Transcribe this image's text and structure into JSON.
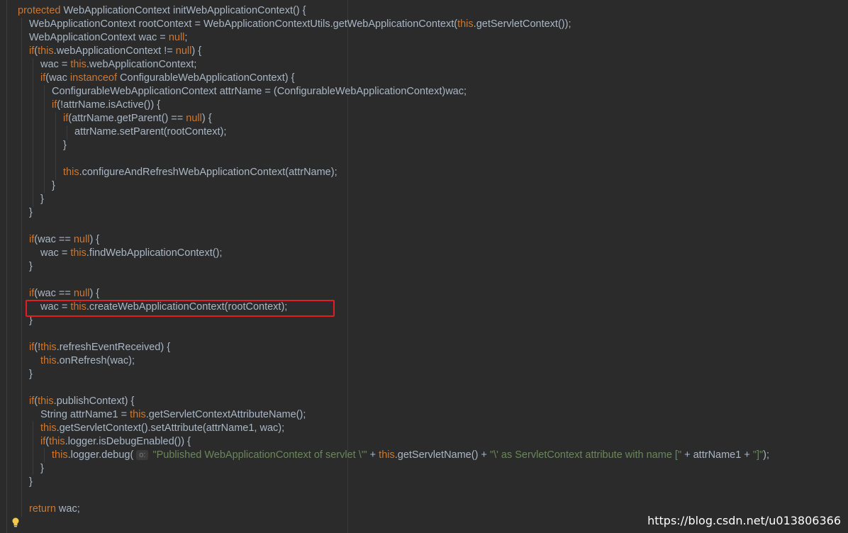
{
  "editor": {
    "lines": [
      {
        "indent": 0,
        "tokens": [
          [
            "kw",
            "protected "
          ],
          [
            "id",
            "WebApplicationContext initWebApplicationContext() {"
          ]
        ]
      },
      {
        "indent": 1,
        "tokens": [
          [
            "id",
            "WebApplicationContext rootContext = WebApplicationContextUtils.getWebApplicationContext("
          ],
          [
            "kw",
            "this"
          ],
          [
            "id",
            ".getServletContext());"
          ]
        ]
      },
      {
        "indent": 1,
        "tokens": [
          [
            "id",
            "WebApplicationContext wac = "
          ],
          [
            "kw",
            "null"
          ],
          [
            "id",
            ";"
          ]
        ]
      },
      {
        "indent": 1,
        "tokens": [
          [
            "kw",
            "if"
          ],
          [
            "id",
            "("
          ],
          [
            "kw",
            "this"
          ],
          [
            "id",
            ".webApplicationContext != "
          ],
          [
            "kw",
            "null"
          ],
          [
            "id",
            ") {"
          ]
        ]
      },
      {
        "indent": 2,
        "tokens": [
          [
            "id",
            "wac = "
          ],
          [
            "kw",
            "this"
          ],
          [
            "id",
            ".webApplicationContext;"
          ]
        ]
      },
      {
        "indent": 2,
        "tokens": [
          [
            "kw",
            "if"
          ],
          [
            "id",
            "(wac "
          ],
          [
            "kw",
            "instanceof "
          ],
          [
            "id",
            "ConfigurableWebApplicationContext) {"
          ]
        ]
      },
      {
        "indent": 3,
        "tokens": [
          [
            "id",
            "ConfigurableWebApplicationContext attrName = (ConfigurableWebApplicationContext)wac;"
          ]
        ]
      },
      {
        "indent": 3,
        "tokens": [
          [
            "kw",
            "if"
          ],
          [
            "id",
            "(!attrName.isActive()) {"
          ]
        ]
      },
      {
        "indent": 4,
        "tokens": [
          [
            "kw",
            "if"
          ],
          [
            "id",
            "(attrName.getParent() == "
          ],
          [
            "kw",
            "null"
          ],
          [
            "id",
            ") {"
          ]
        ]
      },
      {
        "indent": 5,
        "tokens": [
          [
            "id",
            "attrName.setParent(rootContext);"
          ]
        ]
      },
      {
        "indent": 4,
        "tokens": [
          [
            "id",
            "}"
          ]
        ]
      },
      {
        "indent": 0,
        "tokens": []
      },
      {
        "indent": 4,
        "tokens": [
          [
            "kw",
            "this"
          ],
          [
            "id",
            ".configureAndRefreshWebApplicationContext(attrName);"
          ]
        ]
      },
      {
        "indent": 3,
        "tokens": [
          [
            "id",
            "}"
          ]
        ]
      },
      {
        "indent": 2,
        "tokens": [
          [
            "id",
            "}"
          ]
        ]
      },
      {
        "indent": 1,
        "tokens": [
          [
            "id",
            "}"
          ]
        ]
      },
      {
        "indent": 0,
        "tokens": []
      },
      {
        "indent": 1,
        "tokens": [
          [
            "kw",
            "if"
          ],
          [
            "id",
            "(wac == "
          ],
          [
            "kw",
            "null"
          ],
          [
            "id",
            ") {"
          ]
        ]
      },
      {
        "indent": 2,
        "tokens": [
          [
            "id",
            "wac = "
          ],
          [
            "kw",
            "this"
          ],
          [
            "id",
            ".findWebApplicationContext();"
          ]
        ]
      },
      {
        "indent": 1,
        "tokens": [
          [
            "id",
            "}"
          ]
        ]
      },
      {
        "indent": 0,
        "tokens": []
      },
      {
        "indent": 1,
        "tokens": [
          [
            "kw",
            "if"
          ],
          [
            "id",
            "(wac == "
          ],
          [
            "kw",
            "null"
          ],
          [
            "id",
            ") {"
          ]
        ]
      },
      {
        "indent": 2,
        "tokens": [
          [
            "id",
            "wac = "
          ],
          [
            "kw",
            "this"
          ],
          [
            "id",
            ".createWebApplicationContext(rootContext);"
          ]
        ]
      },
      {
        "indent": 1,
        "tokens": [
          [
            "id",
            "}"
          ]
        ]
      },
      {
        "indent": 0,
        "tokens": []
      },
      {
        "indent": 1,
        "tokens": [
          [
            "kw",
            "if"
          ],
          [
            "id",
            "(!"
          ],
          [
            "kw",
            "this"
          ],
          [
            "id",
            ".refreshEventReceived) {"
          ]
        ]
      },
      {
        "indent": 2,
        "tokens": [
          [
            "kw",
            "this"
          ],
          [
            "id",
            ".onRefresh(wac);"
          ]
        ]
      },
      {
        "indent": 1,
        "tokens": [
          [
            "id",
            "}"
          ]
        ]
      },
      {
        "indent": 0,
        "tokens": []
      },
      {
        "indent": 1,
        "tokens": [
          [
            "kw",
            "if"
          ],
          [
            "id",
            "("
          ],
          [
            "kw",
            "this"
          ],
          [
            "id",
            ".publishContext) {"
          ]
        ]
      },
      {
        "indent": 2,
        "tokens": [
          [
            "id",
            "String attrName1 = "
          ],
          [
            "kw",
            "this"
          ],
          [
            "id",
            ".getServletContextAttributeName();"
          ]
        ]
      },
      {
        "indent": 2,
        "tokens": [
          [
            "kw",
            "this"
          ],
          [
            "id",
            ".getServletContext().setAttribute(attrName1, wac);"
          ]
        ]
      },
      {
        "indent": 2,
        "tokens": [
          [
            "kw",
            "if"
          ],
          [
            "id",
            "("
          ],
          [
            "kw",
            "this"
          ],
          [
            "id",
            ".logger.isDebugEnabled()) {"
          ]
        ]
      },
      {
        "indent": 3,
        "tokens": [
          [
            "kw",
            "this"
          ],
          [
            "id",
            ".logger.debug("
          ],
          [
            "hint",
            "o:"
          ],
          [
            "str",
            "\"Published WebApplicationContext of servlet \\'\""
          ],
          [
            "id",
            " + "
          ],
          [
            "kw",
            "this"
          ],
          [
            "id",
            ".getServletName() + "
          ],
          [
            "str",
            "\"\\' as ServletContext attribute with name [\""
          ],
          [
            "id",
            " + attrName1 + "
          ],
          [
            "str",
            "\"]\""
          ],
          [
            "id",
            ");"
          ]
        ]
      },
      {
        "indent": 2,
        "tokens": [
          [
            "id",
            "}"
          ]
        ]
      },
      {
        "indent": 1,
        "tokens": [
          [
            "id",
            "}"
          ]
        ]
      },
      {
        "indent": 0,
        "tokens": []
      },
      {
        "indent": 1,
        "tokens": [
          [
            "kw",
            "return "
          ],
          [
            "id",
            "wac;"
          ]
        ]
      }
    ],
    "highlighted_line": 22
  },
  "watermark": "https://blog.csdn.net/u013806366",
  "colors": {
    "background": "#2b2b2b",
    "keyword": "#cc7832",
    "identifier": "#a9b7c6",
    "string": "#6a8759",
    "highlight_box": "#e02020"
  }
}
